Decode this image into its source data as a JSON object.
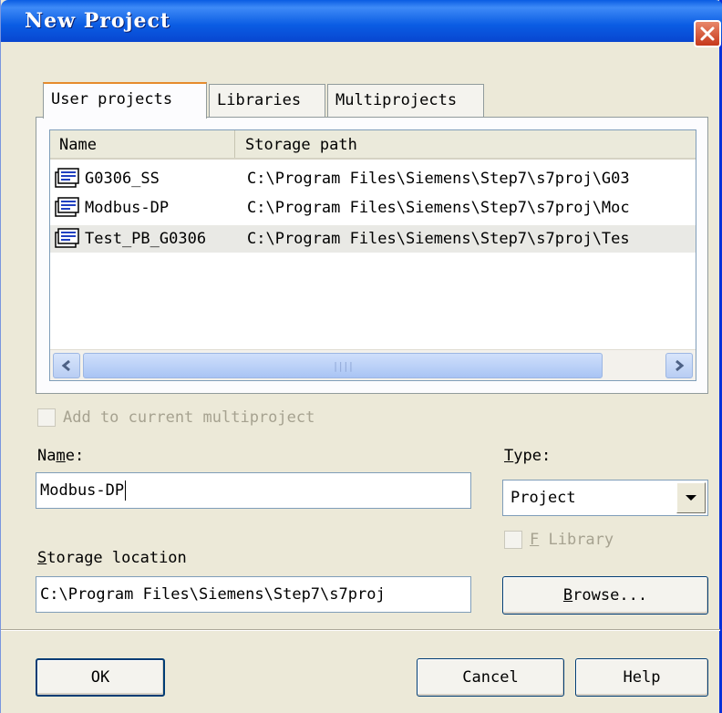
{
  "window": {
    "title": "New Project"
  },
  "tabs": [
    {
      "label": "User projects",
      "active": true
    },
    {
      "label": "Libraries",
      "active": false
    },
    {
      "label": "Multiprojects",
      "active": false
    }
  ],
  "list": {
    "columns": [
      "Name",
      "Storage path"
    ],
    "rows": [
      {
        "name": "G0306_SS",
        "path": "C:\\Program Files\\Siemens\\Step7\\s7proj\\G03"
      },
      {
        "name": "Modbus-DP",
        "path": "C:\\Program Files\\Siemens\\Step7\\s7proj\\Moc"
      },
      {
        "name": "Test_PB_G0306",
        "path": "C:\\Program Files\\Siemens\\Step7\\s7proj\\Tes"
      }
    ]
  },
  "add_to_multiproject": {
    "label": "Add to current multiproject",
    "checked": false,
    "enabled": false
  },
  "name_field": {
    "label_prefix": "Na",
    "label_accel": "m",
    "label_suffix": "e:",
    "value": "Modbus-DP"
  },
  "type_field": {
    "label_accel": "T",
    "label_suffix": "ype:",
    "selected": "Project"
  },
  "f_library": {
    "label_accel": "F",
    "label_suffix": " Library",
    "checked": false,
    "enabled": false
  },
  "storage": {
    "label_accel": "S",
    "label_suffix": "torage location",
    "value": "C:\\Program Files\\Siemens\\Step7\\s7proj"
  },
  "buttons": {
    "browse_accel": "B",
    "browse_suffix": "rowse...",
    "ok": "OK",
    "cancel": "Cancel",
    "help": "Help"
  },
  "colors": {
    "titlebar": "#0a5ce3",
    "dialog_bg": "#ece9d8",
    "close": "#c6381b"
  }
}
